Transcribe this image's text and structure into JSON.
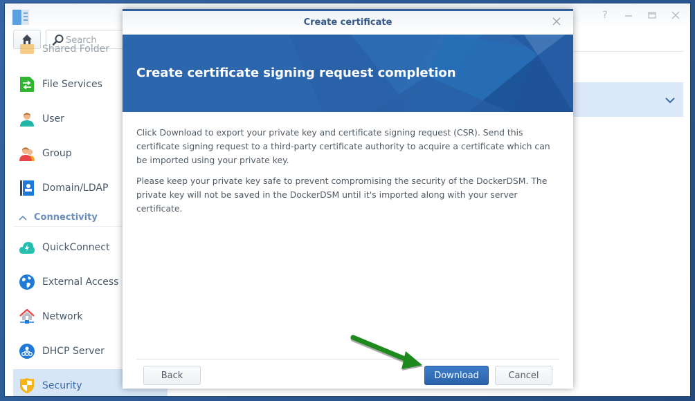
{
  "app": {
    "window_controls": [
      "help",
      "minimize",
      "maximize",
      "close"
    ],
    "search": {
      "placeholder": "Search"
    }
  },
  "sidebar": {
    "items": [
      {
        "label": "Shared Folder",
        "icon": "shared-folder-icon"
      },
      {
        "label": "File Services",
        "icon": "file-services-icon"
      },
      {
        "label": "User",
        "icon": "user-icon"
      },
      {
        "label": "Group",
        "icon": "group-icon"
      },
      {
        "label": "Domain/LDAP",
        "icon": "domain-ldap-icon"
      }
    ],
    "section": {
      "label": "Connectivity",
      "expanded": true
    },
    "section_items": [
      {
        "label": "QuickConnect",
        "icon": "quickconnect-icon"
      },
      {
        "label": "External Access",
        "icon": "external-access-icon"
      },
      {
        "label": "Network",
        "icon": "network-icon"
      },
      {
        "label": "DHCP Server",
        "icon": "dhcp-server-icon"
      },
      {
        "label": "Security",
        "icon": "security-icon",
        "active": true
      }
    ]
  },
  "dialog": {
    "title": "Create certificate",
    "banner_title": "Create certificate signing request completion",
    "paragraphs": [
      "Click Download to export your private key and certificate signing request (CSR). Send this certificate signing request to a third-party certificate authority to acquire a certificate which can be imported using your private key.",
      "Please keep your private key safe to prevent compromising the security of the DockerDSM. The private key will not be saved in the DockerDSM until it's imported along with your server certificate."
    ],
    "buttons": {
      "back": "Back",
      "download": "Download",
      "cancel": "Cancel"
    }
  },
  "colors": {
    "accent": "#2c66ad",
    "primary_button": "#2f6bb5",
    "annotation_arrow": "#1e8a1e",
    "active_nav": "#d7e6f7"
  }
}
